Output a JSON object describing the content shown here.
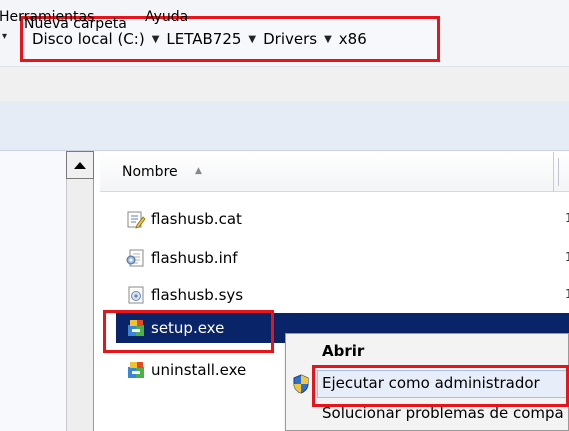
{
  "breadcrumb": {
    "items": [
      "Disco local (C:)",
      "LETAB725",
      "Drivers",
      "x86"
    ]
  },
  "menu": {
    "items": [
      "Herramientas",
      "Ayuda"
    ]
  },
  "toolbar": {
    "new_folder": "Nueva carpeta"
  },
  "list": {
    "column_name": "Nombre",
    "files": [
      {
        "name": "flashusb.cat",
        "icon": "catalog-file-icon"
      },
      {
        "name": "flashusb.inf",
        "icon": "setup-information-icon"
      },
      {
        "name": "flashusb.sys",
        "icon": "system-file-icon"
      },
      {
        "name": "setup.exe",
        "icon": "installer-icon",
        "selected": true
      },
      {
        "name": "uninstall.exe",
        "icon": "installer-icon"
      }
    ]
  },
  "context_menu": {
    "open": "Abrir",
    "run_as_admin": "Ejecutar como administrador",
    "troubleshoot": "Solucionar problemas de compa"
  },
  "colors": {
    "highlight_box": "#e8141c",
    "selection": "#0a246a"
  }
}
